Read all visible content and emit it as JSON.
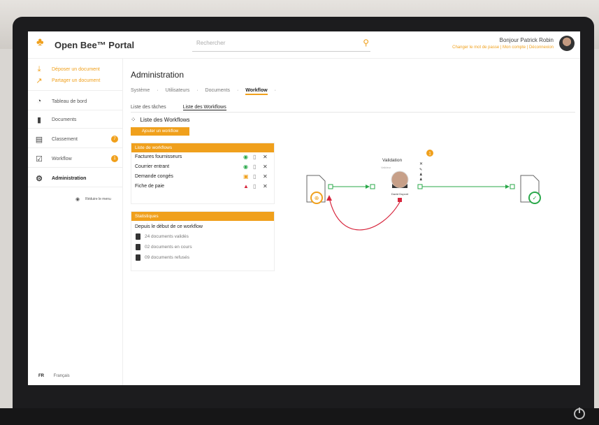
{
  "header": {
    "logo_text": "Open Bee™ Portal",
    "search_placeholder": "Rechercher",
    "greeting": "Bonjour Patrick Robin",
    "sublinks": "Changer le mot de passe | Mon compte | Déconnexion"
  },
  "sidebar": {
    "actions": [
      {
        "label": "Déposer un document"
      },
      {
        "label": "Partager un document"
      }
    ],
    "items": [
      {
        "label": "Tableau de bord"
      },
      {
        "label": "Documents"
      },
      {
        "label": "Classement",
        "badge": "7"
      },
      {
        "label": "Workflow",
        "badge": "1"
      },
      {
        "label": "Administration"
      }
    ],
    "collapse_label": "Réduire le menu",
    "lang_code": "FR",
    "lang_label": "Français"
  },
  "main": {
    "title": "Administration",
    "breadcrumb": [
      "Système",
      "Utilisateurs",
      "Documents",
      "Workflow"
    ],
    "tabs": [
      "Liste des tâches",
      "Liste des Workflows"
    ],
    "list_title": "Liste des Workflows",
    "add_button": "Ajouter un workflow",
    "workflows_head": "Liste de workflows",
    "workflows": [
      {
        "name": "Factures fournisseurs",
        "status": "active"
      },
      {
        "name": "Courrier entrant",
        "status": "active"
      },
      {
        "name": "Demande congés",
        "status": "paused"
      },
      {
        "name": "Fiche de paie",
        "status": "error"
      }
    ],
    "stats_head": "Statistiques",
    "stats_title": "Depuis le début de ce workflow",
    "stats": [
      {
        "label": "24 documents validés"
      },
      {
        "label": "02 documents en cours"
      },
      {
        "label": "09 documents refusés"
      }
    ]
  },
  "diagram": {
    "step_title": "Validation",
    "step_user_role": "Valideur",
    "step_badge": "1",
    "step_user": "David Dupont"
  },
  "colors": {
    "accent": "#f0a01c",
    "green": "#2aa84a",
    "red": "#d7263d"
  }
}
